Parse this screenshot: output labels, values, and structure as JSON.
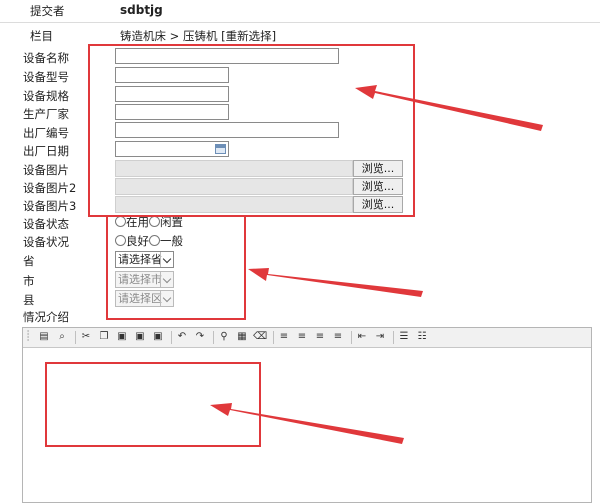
{
  "header": {
    "submitter_label": "提交者",
    "submitter_value": "sdbtjg"
  },
  "column": {
    "label": "栏目",
    "path": "铸造机床 > 压铸机",
    "reselect_link": "[重新选择]"
  },
  "fields": {
    "name": {
      "label": "设备名称",
      "value": ""
    },
    "model": {
      "label": "设备型号",
      "value": ""
    },
    "spec": {
      "label": "设备规格",
      "value": ""
    },
    "manufacturer": {
      "label": "生产厂家",
      "value": ""
    },
    "serial": {
      "label": "出厂编号",
      "value": ""
    },
    "date": {
      "label": "出厂日期",
      "value": ""
    },
    "image1": {
      "label": "设备图片",
      "browse": "浏览..."
    },
    "image2": {
      "label": "设备图片2",
      "browse": "浏览..."
    },
    "image3": {
      "label": "设备图片3",
      "browse": "浏览..."
    },
    "status": {
      "label": "设备状态",
      "options": [
        "在用",
        "闲置"
      ]
    },
    "condition": {
      "label": "设备状况",
      "options": [
        "良好",
        "一般"
      ]
    },
    "province": {
      "label": "省",
      "selected": "请选择省"
    },
    "city": {
      "label": "市",
      "selected": "请选择市"
    },
    "county": {
      "label": "县",
      "selected": "请选择区"
    },
    "description": {
      "label": "情况介绍",
      "value": ""
    }
  },
  "colors": {
    "annotation_red": "#e0383b",
    "border": "#8a8a8a",
    "toolbar_bg": "#f1f1f1"
  },
  "toolbar_icons": [
    "source-icon",
    "preview-icon",
    "cut-icon",
    "copy-icon",
    "paste-icon",
    "paste-text-icon",
    "paste-word-icon",
    "undo-icon",
    "redo-icon",
    "find-icon",
    "table-icon",
    "eraser-icon",
    "align-left-icon",
    "align-center-icon",
    "align-right-icon",
    "align-justify-icon",
    "outdent-icon",
    "indent-icon",
    "ordered-list-icon",
    "unordered-list-icon"
  ]
}
